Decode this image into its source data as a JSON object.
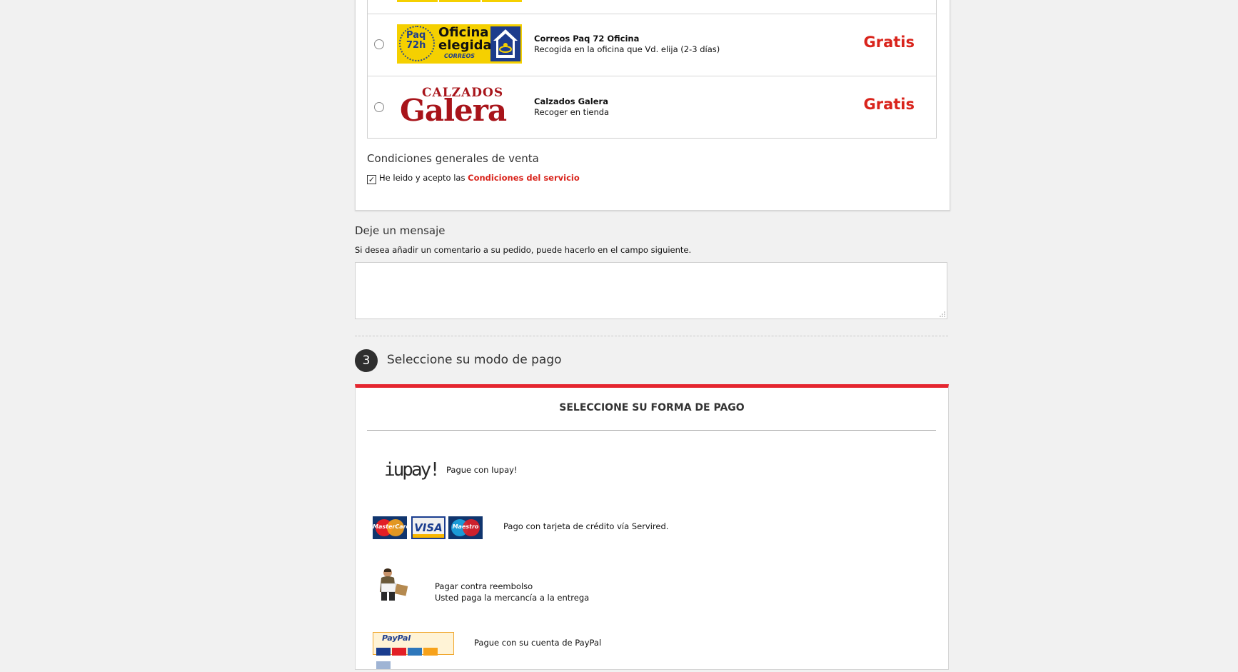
{
  "shipping": {
    "carriers": [
      {
        "name": "Correos Paq 72 Oficina",
        "description": "Recogida en la oficina que Vd. elija (2-3 días)",
        "price": "Gratis",
        "logo": {
          "line1": "Paq",
          "line2": "72h",
          "title1": "Oficina",
          "title2": "elegida",
          "brand": "CORREOS"
        }
      },
      {
        "name": "Calzados Galera",
        "description": "Recoger en tienda",
        "price": "Gratis",
        "logo": {
          "top": "CALZADOS",
          "main": "Galera"
        }
      }
    ],
    "conditions": {
      "title": "Condiciones generales de venta",
      "checkbox_checked": true,
      "checkbox_text": "He leido y acepto las",
      "link_text": "Condiciones del servicio"
    }
  },
  "message": {
    "title": "Deje un mensaje",
    "subtitle": "Si desea añadir un comentario a su pedido, puede hacerlo en el campo siguiente.",
    "value": ""
  },
  "payment": {
    "step_number": "3",
    "step_title": "Seleccione su modo de pago",
    "heading": "SELECCIONE SU FORMA DE PAGO",
    "methods": [
      {
        "label": "Pague con Iupay!",
        "icon": "iupay-logo",
        "logo_text": "iupay!"
      },
      {
        "label": "Pago con tarjeta de crédito vía Servired.",
        "icon": "credit-cards-logo",
        "cards": [
          "MasterCard",
          "VISA",
          "Maestro"
        ]
      },
      {
        "label_line1": "Pagar contra reembolso",
        "label_line2": "Usted paga la mercancía a la entrega",
        "icon": "delivery-man-icon"
      },
      {
        "label": "Pague con su cuenta de PayPal",
        "icon": "paypal-logo",
        "logo_text": "PayPal"
      }
    ]
  },
  "colors": {
    "accent_red": "#e5262f",
    "price_red": "#d9241c",
    "background": "#f1f1f1",
    "step_circle": "#2f2f2f"
  }
}
